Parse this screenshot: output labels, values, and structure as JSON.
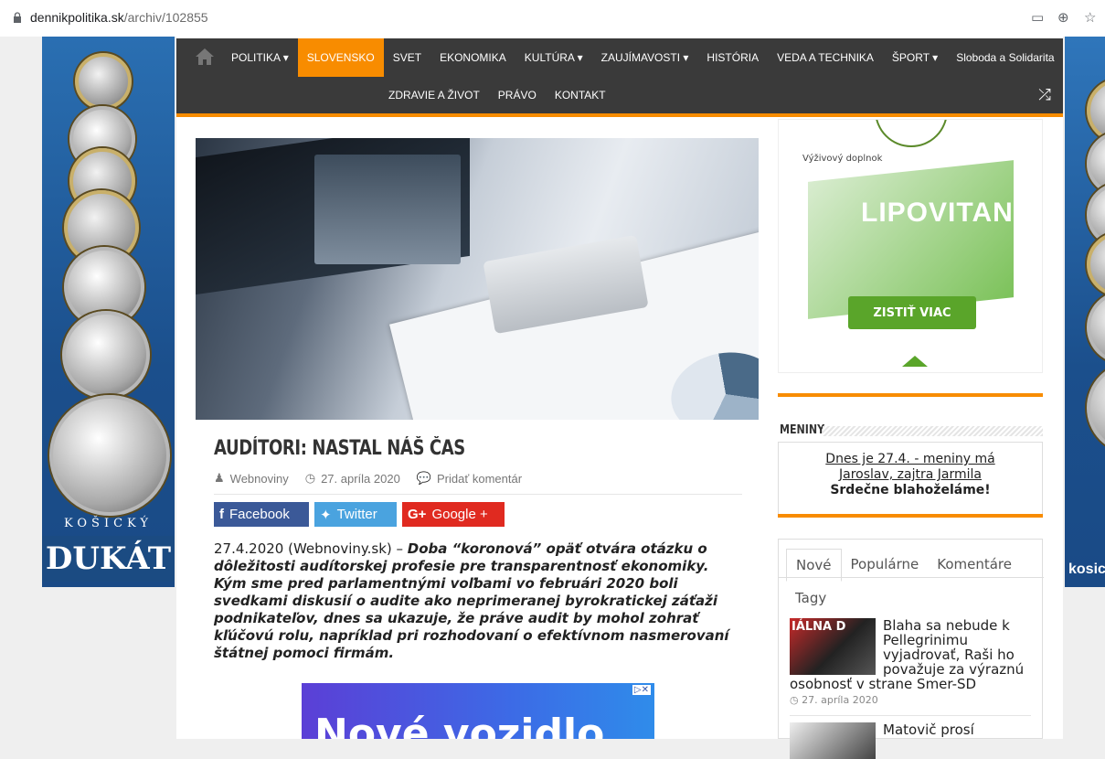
{
  "browser": {
    "url_host": "dennikpolitika.sk",
    "url_path": "/archiv/102855",
    "icons": [
      "lock-icon",
      "reader-mode-icon",
      "zoom-icon",
      "bookmark-star-icon"
    ]
  },
  "ads": {
    "left_line1": "KOŠICKÝ",
    "left_line2": "DUKÁT",
    "right_text": "kosic"
  },
  "nav": {
    "row1": [
      "POLITIKA ▾",
      "SLOVENSKO",
      "SVET",
      "EKONOMIKA",
      "KULTÚRA ▾",
      "ZAUJÍMAVOSTI ▾",
      "HISTÓRIA",
      "VEDA A TECHNIKA",
      "ŠPORT ▾",
      "Sloboda a Solidarita"
    ],
    "row2": [
      "ZDRAVIE A ŽIVOT",
      "PRÁVO",
      "KONTAKT"
    ],
    "active": "SLOVENSKO",
    "accent": "#f88c00"
  },
  "article": {
    "title": "AUDÍTORI: NASTAL NÁŠ ČAS",
    "author": "Webnoviny",
    "date": "27. apríla 2020",
    "comment": "Pridať komentár",
    "share": {
      "facebook": "Facebook",
      "twitter": "Twitter",
      "google": "Google +"
    },
    "lead_plain": "27.4.2020 (Webnoviny.sk) – ",
    "lead_bold": "Doba “koronová” opäť otvára otázku o dôležitosti audítorskej profesie pre transparentnosť ekonomiky. Kým sme pred parlamentnými voľbami vo februári 2020 boli svedkami diskusií o audite ako neprimeranej byrokratickej záťaži podnikateľov, dnes sa ukazuje, že práve audit by mohol zohrať kľúčovú rolu, napríklad pri rozhodovaní o efektívnom nasmerovaní štátnej pomoci firmám."
  },
  "inline_ad": {
    "tag": "▷✕",
    "text": "Nové vozidlo"
  },
  "sidebar_ad": {
    "label": "Výživový doplnok",
    "brand": "LIPOVITAN S",
    "button": "ZISTIŤ VIAC"
  },
  "meniny": {
    "heading": "MENINY",
    "line1": "Dnes je 27.4. - meniny má",
    "line2": "Jaroslav, zajtra Jarmila",
    "greet": "Srdečne blahoželáme!"
  },
  "tabs": {
    "items": [
      "Nové",
      "Populárne",
      "Komentáre"
    ],
    "active": "Nové",
    "tagy": "Tagy"
  },
  "news": [
    {
      "title": "Blaha sa nebude k Pellegrinimu vyjadrovať, Raši ho považuje za výraznú osobnosť v strane Smer-SD",
      "date": "27. apríla 2020",
      "thumb_text": "IÁLNA D"
    },
    {
      "title": "Matovič prosí",
      "date": ""
    }
  ]
}
